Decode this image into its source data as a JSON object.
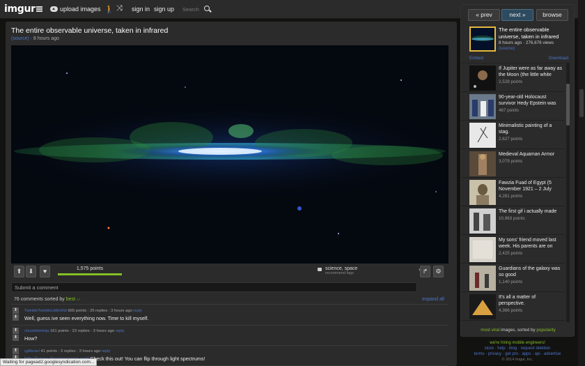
{
  "topbar": {
    "logo": "imgur",
    "upload_label": "upload images",
    "signin_label": "sign in",
    "signup_label": "sign up",
    "search_placeholder": "Search"
  },
  "post": {
    "title": "The entire observable universe, taken in infrared",
    "source_label": "(source)",
    "age": "· 8 hours ago",
    "points_label": "1,575 points",
    "points_fraction": 1.0,
    "tags_label": "science, space",
    "recommend_tags_label": "recommend tags"
  },
  "comment_form": {
    "placeholder": "Submit a comment"
  },
  "comments_header": {
    "count_label": "76 comments sorted by",
    "sort_value": "best",
    "expand_label": "expand all"
  },
  "comments": [
    {
      "user": "TwinkleTwinkleLittleShit",
      "meta": " 665 points : 25 replies : 3 hours ago ",
      "reply": "reply",
      "text": "Well, guess ive seen everything now. Time to kill myself.",
      "link": ""
    },
    {
      "user": "chucktheninja",
      "meta": " 161 points : 23 replies : 3 hours ago ",
      "reply": "reply",
      "text": "How?",
      "link": ""
    },
    {
      "user": "rgAbrael",
      "meta": " 41 points : 3 replies : 3 hours ago ",
      "reply": "reply",
      "text": " Check this out! You can flip through light spectrums!",
      "link": "http://www.chromoscope.net/"
    }
  ],
  "status_text": "Waiting for pagead2.googlesyndication.com...",
  "sidebar": {
    "prev_label": "« prev",
    "next_label": "next »",
    "browse_label": "browse",
    "current": {
      "title": "The entire observable universe, taken in infrared",
      "meta": "8 hours ago · 276,676 views",
      "source": "(source)"
    },
    "embed_label": "Embed",
    "download_label": "Download",
    "items": [
      {
        "title": "If Jupiter were as far away as the Moon (the little white",
        "points": "2,528 points"
      },
      {
        "title": "90-year-old Holocaust survivor Hedy Epstein was",
        "points": "467 points"
      },
      {
        "title": "Minimalistic painting of a stag.",
        "points": "2,627 points"
      },
      {
        "title": "Medieval Aquaman Armor",
        "points": "3,079 points"
      },
      {
        "title": "Fawzia Fuad of Egypt (5 November 1921 – 2 July",
        "points": "4,281 points"
      },
      {
        "title": "The first gif i actually made",
        "points": "10,963 points"
      },
      {
        "title": "My sons' friend moved last week. His parents are on",
        "points": "2,425 points"
      },
      {
        "title": "Guardians of the galaxy was so good",
        "points": "1,140 points"
      },
      {
        "title": "It's all a matter of perspective.",
        "points": "4,366 points"
      }
    ],
    "footer_prefix": "most viral",
    "footer_middle": " images, sorted by ",
    "footer_sort": "popularity"
  },
  "footer": {
    "hiring": "we're hiring mobile engineers!",
    "links1": "store · help · blog · request deletion",
    "links2": "terms · privacy · get pro · apps · api · advertise",
    "copyright": "© 2014 Imgur, Inc."
  }
}
